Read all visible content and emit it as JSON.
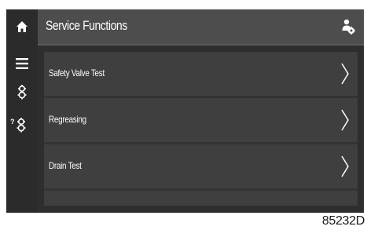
{
  "header": {
    "title": "Service Functions"
  },
  "sidebar": {
    "items": [
      {
        "icon": "home-icon"
      },
      {
        "icon": "menu-icon"
      },
      {
        "icon": "gears-icon"
      },
      {
        "icon": "help-gears-icon"
      }
    ]
  },
  "user_icon": "user-settings-icon",
  "menu": {
    "items": [
      {
        "label": "Safety Valve Test"
      },
      {
        "label": "Regreasing"
      },
      {
        "label": "Drain Test"
      }
    ]
  },
  "footer": {
    "code": "85232D"
  },
  "colors": {
    "header_bg": "#4d4d4d",
    "screen_bg": "#2e2e2e",
    "row_bg": "#3f3f3f",
    "text": "#ffffff"
  }
}
